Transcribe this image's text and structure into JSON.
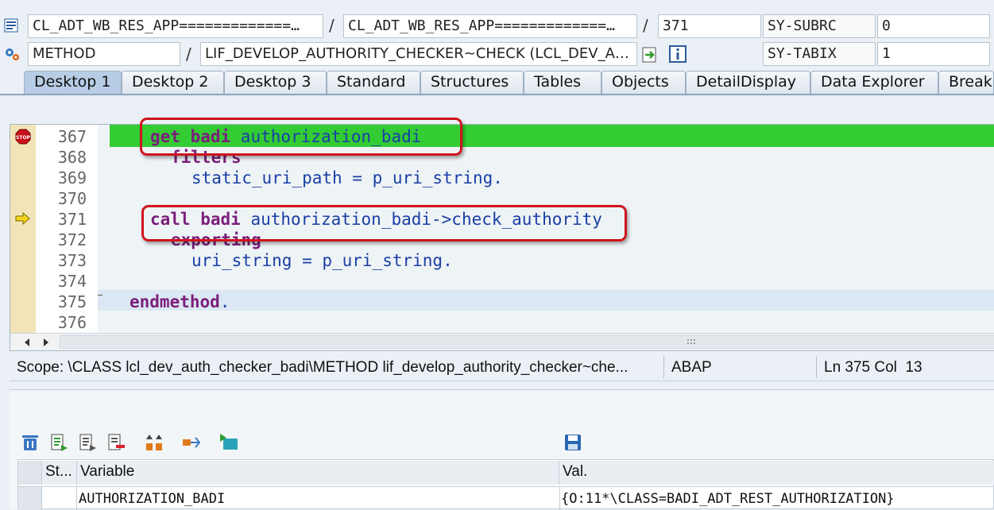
{
  "header": {
    "row1": {
      "program": "CL_ADT_WB_RES_APP=============…",
      "include": "CL_ADT_WB_RES_APP=============…",
      "line": "371",
      "sysvar1_name": "SY-SUBRC",
      "sysvar1_value": "0"
    },
    "row2": {
      "type": "METHOD",
      "event": "LIF_DEVELOP_AUTHORITY_CHECKER~CHECK (LCL_DEV_A…",
      "sysvar2_name": "SY-TABIX",
      "sysvar2_value": "1"
    },
    "slash": "/"
  },
  "tabs": [
    "Desktop 1",
    "Desktop 2",
    "Desktop 3",
    "Standard",
    "Structures",
    "Tables",
    "Objects",
    "DetailDisplay",
    "Data Explorer",
    "Break."
  ],
  "editor": {
    "lines": [
      {
        "num": "367",
        "kw": "get badi",
        "rest": " authorization_badi",
        "indent": 0
      },
      {
        "num": "368",
        "kw": "filters",
        "rest": "",
        "indent": 1
      },
      {
        "num": "369",
        "kw": "",
        "rest": "static_uri_path = p_uri_string.",
        "indent": 2
      },
      {
        "num": "370",
        "kw": "",
        "rest": "",
        "indent": 0
      },
      {
        "num": "371",
        "kw": "call badi",
        "rest": " authorization_badi->check_authority",
        "indent": 0
      },
      {
        "num": "372",
        "kw": "exporting",
        "rest": "",
        "indent": 1
      },
      {
        "num": "373",
        "kw": "",
        "rest": "uri_string = p_uri_string.",
        "indent": 2
      },
      {
        "num": "374",
        "kw": "",
        "rest": "",
        "indent": 0
      },
      {
        "num": "375",
        "kw": "endmethod",
        "rest": ".",
        "indent": -1
      },
      {
        "num": "376",
        "kw": "",
        "rest": "",
        "indent": 0
      }
    ]
  },
  "status": {
    "scope": "Scope: \\CLASS lcl_dev_auth_checker_badi\\METHOD lif_develop_authority_checker~che...",
    "language": "ABAP",
    "position": "Ln 375 Col  13"
  },
  "variables": {
    "columns": [
      "St...",
      "Variable",
      "Val."
    ],
    "rows": [
      {
        "variable": "AUTHORIZATION_BADI",
        "value": "{O:11*\\CLASS=BADI_ADT_REST_AUTHORIZATION}"
      }
    ]
  },
  "colors": {
    "current_line": "#33cc33",
    "highlight_border": "#d0141c",
    "keyword": "#7b1e7b",
    "identifier": "#1a3fa6"
  }
}
